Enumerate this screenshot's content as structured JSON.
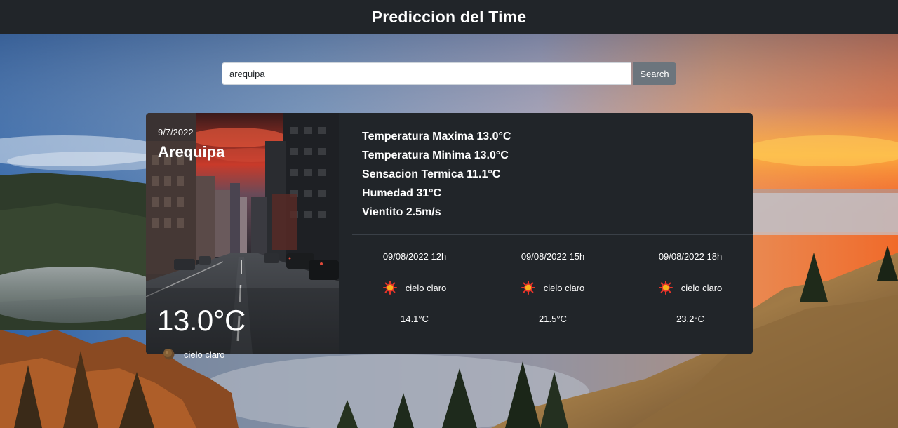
{
  "header": {
    "title": "Prediccion del Time"
  },
  "search": {
    "value": "arequipa",
    "button_label": "Search"
  },
  "current": {
    "date": "9/7/2022",
    "city": "Arequipa",
    "temperature": "13.0°C",
    "condition": "cielo claro",
    "condition_icon": "clear-sky-icon"
  },
  "stats": {
    "max": "Temperatura Maxima 13.0°C",
    "min": "Temperatura Minima 13.0°C",
    "feels_like": "Sensacion Termica 11.1°C",
    "humidity": "Humedad 31°C",
    "wind": "Vientito 2.5m/s"
  },
  "forecast": [
    {
      "time": "09/08/2022 12h",
      "condition": "cielo claro",
      "icon": "sun-icon",
      "temp": "14.1°C"
    },
    {
      "time": "09/08/2022 15h",
      "condition": "cielo claro",
      "icon": "sun-icon",
      "temp": "21.5°C"
    },
    {
      "time": "09/08/2022 18h",
      "condition": "cielo claro",
      "icon": "sun-icon",
      "temp": "23.2°C"
    }
  ],
  "colors": {
    "navbar": "#212529",
    "card": "#212529",
    "button": "#6c757d",
    "sun": "#e8342a"
  }
}
